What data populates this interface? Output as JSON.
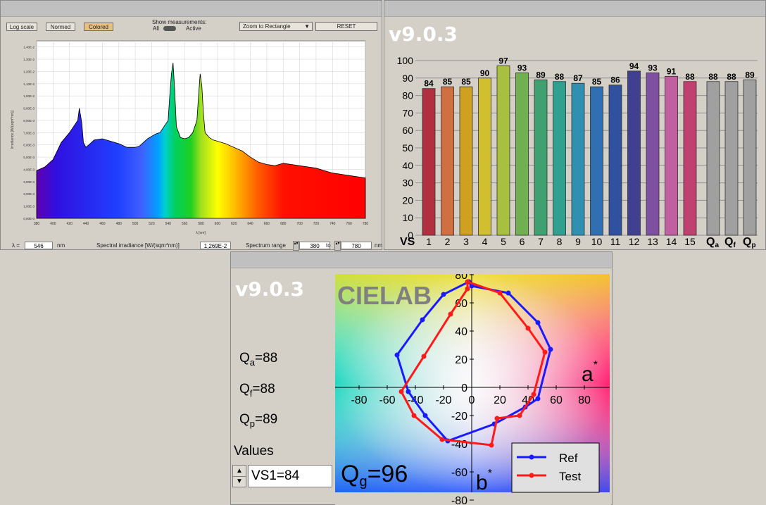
{
  "spectrum_panel": {
    "buttons": {
      "log_scale": "Log scale",
      "normed": "Normed",
      "colored": "Colored",
      "zoom": "Zoom to Rectangle",
      "reset": "RESET"
    },
    "show_measurements_label": "Show measurements:",
    "show_all": "All",
    "show_active": "Active",
    "ylabel": "Irradiance [W/(sqm*nm)]",
    "xlabel": "λ [nm]",
    "yticks": [
      "0,00E-0",
      "1,00E-3",
      "2,00E-3",
      "3,00E-3",
      "4,00E-3",
      "5,00E-3",
      "6,00E-3",
      "7,00E-3",
      "8,00E-3",
      "9,00E-3",
      "1,00E-2",
      "1,10E-2",
      "1,20E-2",
      "1,30E-2",
      "1,40E-2"
    ],
    "xticks": [
      "380",
      "400",
      "420",
      "440",
      "460",
      "480",
      "500",
      "520",
      "540",
      "560",
      "580",
      "600",
      "620",
      "640",
      "660",
      "680",
      "700",
      "720",
      "740",
      "760",
      "780"
    ],
    "lambda_label": "λ =",
    "lambda_value": "546",
    "lambda_unit": "nm",
    "spectral_irradiance_label": "Spectral irradiance [W/(sqm*nm)]",
    "spectral_irradiance_value": "1,269E-2",
    "range_label": "Spectrum range",
    "range_from": "380",
    "range_to_label": "to",
    "range_to": "780",
    "range_unit": "nm"
  },
  "bars_panel": {
    "version": "v9.0.3",
    "vs_label": "VS",
    "yticks": [
      "0",
      "10",
      "20",
      "30",
      "40",
      "50",
      "60",
      "70",
      "80",
      "90",
      "100"
    ],
    "q_labels": [
      {
        "main": "Q",
        "sub": "a"
      },
      {
        "main": "Q",
        "sub": "f"
      },
      {
        "main": "Q",
        "sub": "p"
      }
    ]
  },
  "cielab_panel": {
    "version": "v9.0.3",
    "chart_title": "CIELAB",
    "qa": "Q",
    "qa_sub": "a",
    "qa_val": "=88",
    "qf": "Q",
    "qf_sub": "f",
    "qf_val": "=88",
    "qp": "Q",
    "qp_sub": "p",
    "qp_val": "=89",
    "qg": "Q",
    "qg_sub": "g",
    "qg_val": "=96",
    "values_label": "Values",
    "values_selected": "VS1=84",
    "a_axis": "a",
    "b_axis": "b",
    "axis_star": "*",
    "xticks": [
      "-80",
      "-60",
      "-40",
      "-20",
      "0",
      "20",
      "40",
      "60",
      "80"
    ],
    "yticks": [
      "80",
      "60",
      "40",
      "20",
      "0",
      "-20",
      "-40",
      "-60",
      "-80"
    ]
  },
  "colors": {
    "ref": "#1a1aff",
    "test": "#ff1a1a",
    "q_bars": "#a0a0a0"
  },
  "chart_data": [
    {
      "type": "area",
      "xlabel": "λ [nm]",
      "ylabel": "Irradiance [W/(sqm*nm)]",
      "xlim": [
        380,
        780
      ],
      "ylim": [
        0,
        0.0145
      ],
      "x": [
        380,
        390,
        400,
        405,
        410,
        415,
        420,
        425,
        430,
        432,
        435,
        437,
        440,
        445,
        450,
        460,
        470,
        480,
        490,
        500,
        505,
        510,
        515,
        520,
        525,
        530,
        535,
        540,
        542,
        544,
        546,
        548,
        550,
        555,
        560,
        565,
        570,
        575,
        577,
        579,
        581,
        583,
        585,
        590,
        595,
        600,
        610,
        620,
        630,
        640,
        650,
        660,
        670,
        680,
        690,
        700,
        710,
        720,
        730,
        740,
        750,
        760,
        770,
        780
      ],
      "y": [
        0.0039,
        0.0042,
        0.0048,
        0.0055,
        0.0062,
        0.0066,
        0.007,
        0.0075,
        0.008,
        0.009,
        0.0078,
        0.0062,
        0.0058,
        0.0061,
        0.0064,
        0.0065,
        0.0063,
        0.0061,
        0.0058,
        0.0058,
        0.0059,
        0.0062,
        0.0065,
        0.0067,
        0.0069,
        0.007,
        0.0075,
        0.008,
        0.01,
        0.0118,
        0.0127,
        0.0105,
        0.0075,
        0.0066,
        0.0065,
        0.0066,
        0.007,
        0.008,
        0.01,
        0.0118,
        0.0108,
        0.0085,
        0.007,
        0.0066,
        0.0064,
        0.0063,
        0.0061,
        0.0058,
        0.0055,
        0.005,
        0.0046,
        0.0044,
        0.0043,
        0.0045,
        0.0044,
        0.0043,
        0.0042,
        0.0041,
        0.0039,
        0.0037,
        0.0036,
        0.0035,
        0.0034,
        0.0033
      ]
    },
    {
      "type": "bar",
      "categories": [
        "1",
        "2",
        "3",
        "4",
        "5",
        "6",
        "7",
        "8",
        "9",
        "10",
        "11",
        "12",
        "13",
        "14",
        "15",
        "Qa",
        "Qf",
        "Qp"
      ],
      "values": [
        84,
        85,
        85,
        90,
        97,
        93,
        89,
        88,
        87,
        85,
        86,
        94,
        93,
        91,
        88,
        88,
        88,
        89
      ],
      "ylim": [
        0,
        100
      ],
      "colors": [
        "#b03040",
        "#d07040",
        "#d0a020",
        "#d0c030",
        "#a8c040",
        "#70b050",
        "#40a070",
        "#30a090",
        "#3090b0",
        "#3070b0",
        "#3050a0",
        "#404090",
        "#8050a0",
        "#c060a0",
        "#c04070",
        "#a0a0a0",
        "#a0a0a0",
        "#a0a0a0"
      ]
    },
    {
      "type": "line",
      "xlabel": "a*",
      "ylabel": "b*",
      "xlim": [
        -90,
        90
      ],
      "ylim": [
        -85,
        85
      ],
      "series": [
        {
          "name": "Ref",
          "x": [
            0,
            26,
            47,
            56,
            47,
            38,
            16,
            -17,
            -33,
            -45,
            -53,
            -35,
            -20,
            -2
          ],
          "y": [
            72,
            67,
            46,
            27,
            -8,
            -14,
            -26,
            -38,
            -20,
            -3,
            23,
            48,
            66,
            75
          ]
        },
        {
          "name": "Test",
          "x": [
            -3,
            20,
            40,
            52,
            44,
            34,
            18,
            14,
            -21,
            -41,
            -50,
            -34,
            -15,
            -3
          ],
          "y": [
            75,
            67,
            42,
            25,
            -5,
            -20,
            -22,
            -41,
            -37,
            -20,
            -3,
            22,
            52,
            70
          ]
        }
      ]
    }
  ]
}
